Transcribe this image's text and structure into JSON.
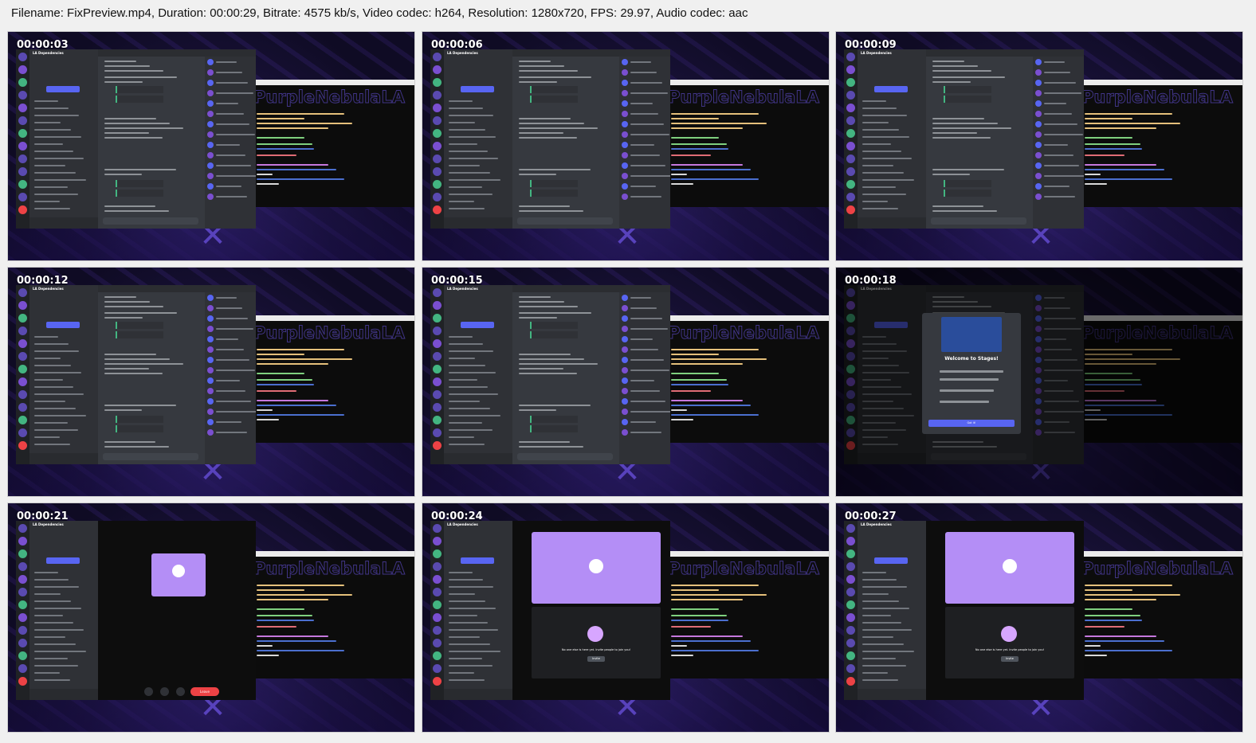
{
  "header": {
    "info_line": "Filename: FixPreview.mp4, Duration: 00:00:29, Bitrate: 4575 kb/s, Video codec: h264, Resolution: 1280x720, FPS: 29.97, Audio codec: aac"
  },
  "thumbnails": [
    {
      "timestamp": "00:00:03",
      "scene": "discord-chat"
    },
    {
      "timestamp": "00:00:06",
      "scene": "discord-chat"
    },
    {
      "timestamp": "00:00:09",
      "scene": "discord-chat"
    },
    {
      "timestamp": "00:00:12",
      "scene": "discord-chat"
    },
    {
      "timestamp": "00:00:15",
      "scene": "discord-chat"
    },
    {
      "timestamp": "00:00:18",
      "scene": "stages-modal"
    },
    {
      "timestamp": "00:00:21",
      "scene": "voice-call"
    },
    {
      "timestamp": "00:00:24",
      "scene": "invite-view"
    },
    {
      "timestamp": "00:00:27",
      "scene": "invite-view"
    }
  ],
  "discord": {
    "server_name": "LA Dependencies",
    "invite_label": "Invite People"
  },
  "stages_modal": {
    "title": "Welcome to Stages!",
    "button_label": "Got it!"
  },
  "call": {
    "leave_label": "Leave",
    "invite_text": "No one else is here yet. Invite people to join you!",
    "invite_button": "Invite"
  },
  "colors": {
    "discord_dark": "#36393f",
    "sidebar": "#2f3136",
    "blurple": "#5865f2",
    "tile_purple": "#b48ef6",
    "leave_red": "#ed4245"
  }
}
